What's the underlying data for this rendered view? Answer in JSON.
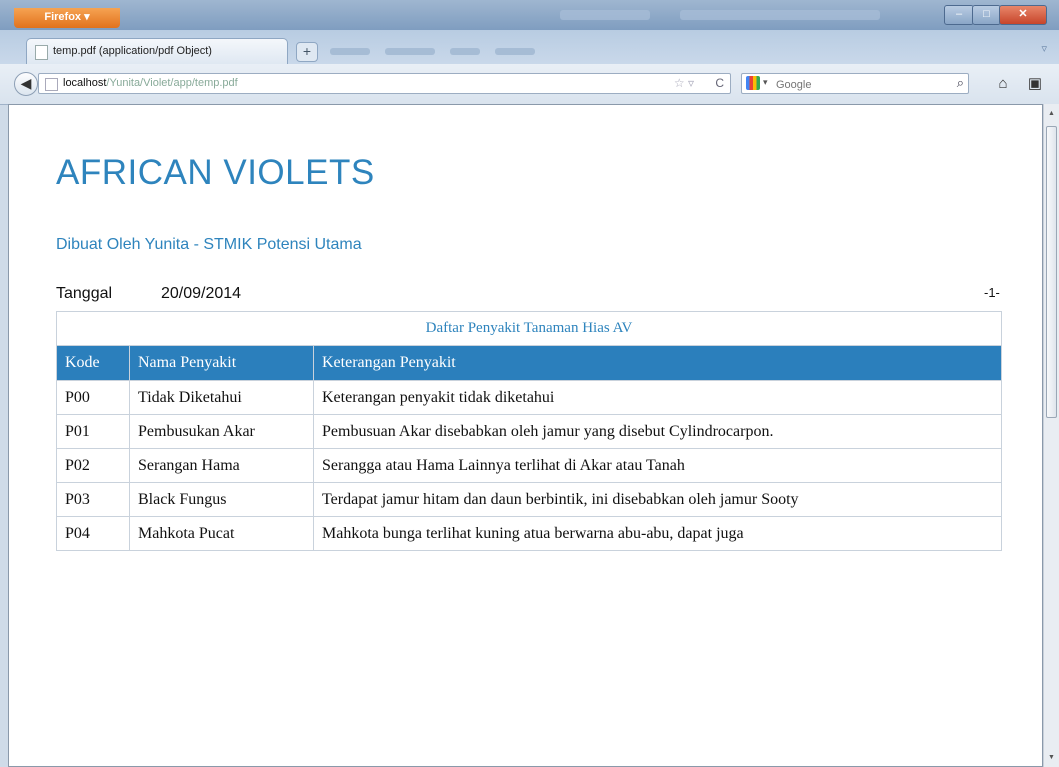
{
  "browser": {
    "app_button": "Firefox",
    "tab_title": "temp.pdf (application/pdf Object)",
    "new_tab": "+",
    "url_host": "localhost",
    "url_path": "/Yunita/Violet/app/temp.pdf",
    "search_placeholder": "Google"
  },
  "document": {
    "title": "AFRICAN VIOLETS",
    "subtitle": "Dibuat Oleh Yunita - STMIK Potensi Utama",
    "date_label": "Tanggal",
    "date_value": "20/09/2014",
    "page_number": "-1-",
    "table": {
      "caption": "Daftar Penyakit Tanaman Hias AV",
      "headers": [
        "Kode",
        "Nama Penyakit",
        "Keterangan Penyakit"
      ],
      "rows": [
        [
          "P00",
          "Tidak Diketahui",
          "Keterangan penyakit tidak diketahui"
        ],
        [
          "P01",
          "Pembusukan Akar",
          "Pembusuan Akar disebabkan oleh jamur yang disebut Cylindrocarpon."
        ],
        [
          "P02",
          "Serangan Hama",
          "Serangga atau Hama Lainnya terlihat  di Akar atau Tanah"
        ],
        [
          "P03",
          "Black Fungus",
          "Terdapat jamur hitam dan daun berbintik, ini disebabkan oleh jamur Sooty"
        ],
        [
          "P04",
          "Mahkota Pucat",
          "Mahkota bunga terlihat kuning atua berwarna abu-abu, dapat juga"
        ]
      ]
    }
  },
  "colors": {
    "accent": "#2e84bd",
    "header_bg": "#2b7fbc"
  }
}
